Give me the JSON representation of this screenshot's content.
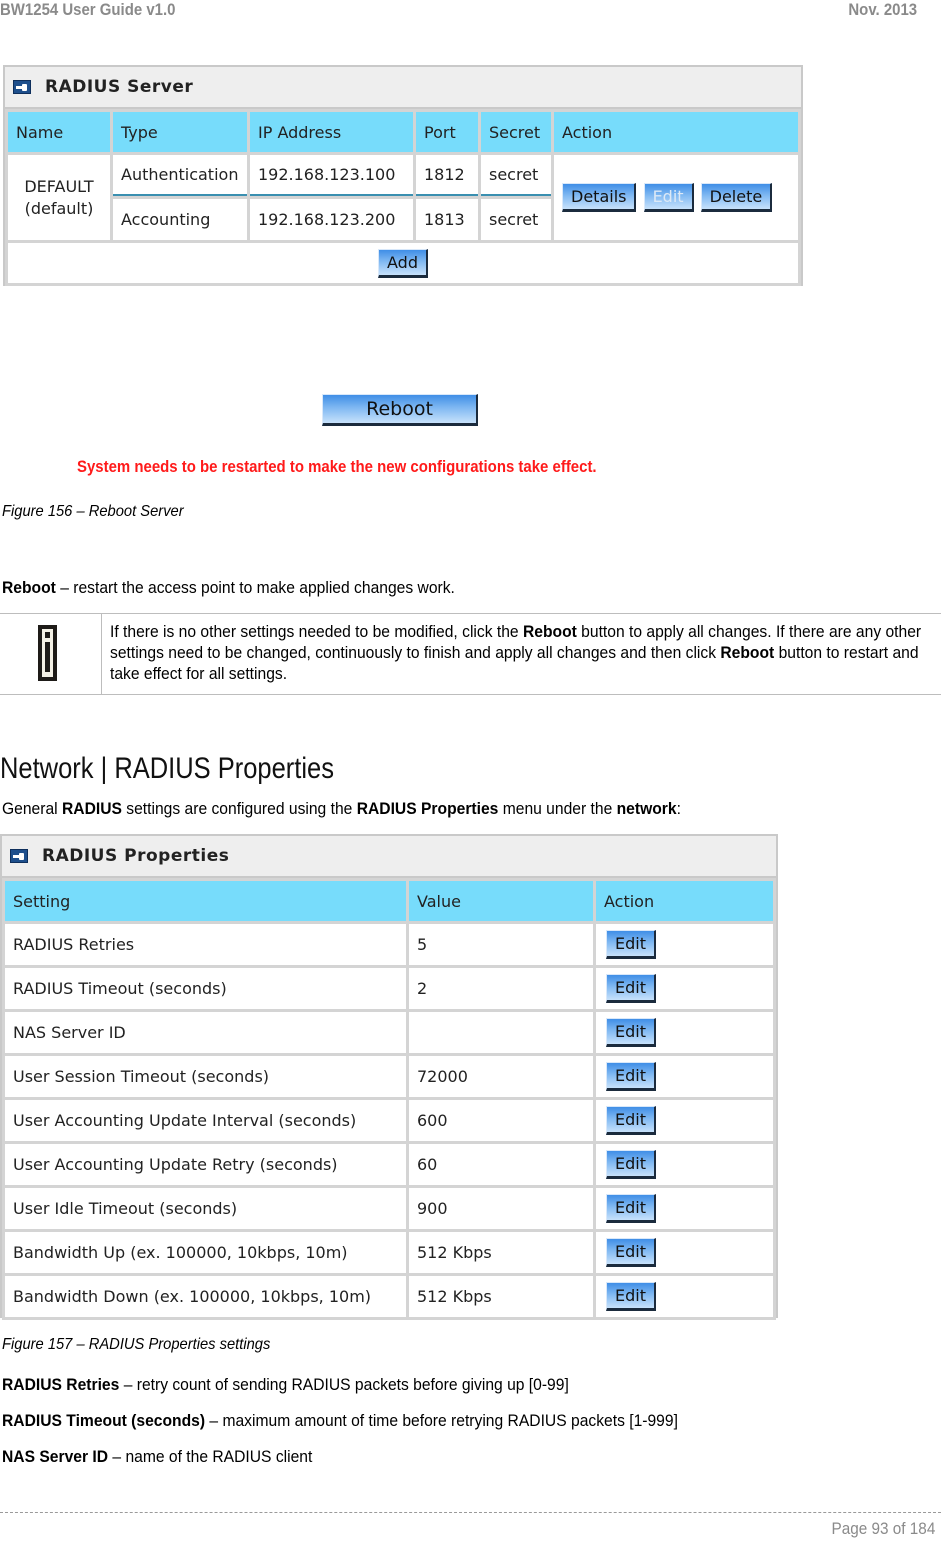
{
  "header": {
    "doc_title": "BW1254 User Guide v1.0",
    "date": "Nov.  2013"
  },
  "radius_server_panel": {
    "title": "RADIUS Server",
    "icon": "arrow-panel-icon",
    "columns": [
      "Name",
      "Type",
      "IP Address",
      "Port",
      "Secret",
      "Action"
    ],
    "server": {
      "name": "DEFAULT",
      "name_sub": "(default)",
      "entries": [
        {
          "type": "Authentication",
          "ip": "192.168.123.100",
          "port": "1812",
          "secret": "secret"
        },
        {
          "type": "Accounting",
          "ip": "192.168.123.200",
          "port": "1813",
          "secret": "secret"
        }
      ],
      "actions": {
        "details": "Details",
        "edit": "Edit",
        "delete": "Delete"
      }
    },
    "add_label": "Add",
    "header_color": "#77dcfb"
  },
  "reboot": {
    "button_label": "Reboot",
    "warning": "System needs to be restarted to make the new configurations take effect.",
    "warning_color": "#ff1a1a"
  },
  "figure156_caption": "Figure 156 – Reboot Server",
  "reboot_desc": {
    "term": "Reboot",
    "text": " – restart the access point to make applied changes work."
  },
  "note": {
    "icon": "info-icon",
    "parts": [
      "If there is no other settings needed to be modified, click the ",
      "Reboot",
      " button to apply all changes. If there are any other settings need to be changed, continuously to finish and apply all changes and then click ",
      "Reboot",
      " button to restart and take effect  for all settings."
    ]
  },
  "section": {
    "title": "Network | RADIUS Properties",
    "intro_parts": [
      "General ",
      "RADIUS",
      " settings are configured using the ",
      "RADIUS Properties",
      " menu under the ",
      "network",
      ":"
    ]
  },
  "radius_properties_panel": {
    "title": "RADIUS Properties",
    "columns": [
      "Setting",
      "Value",
      "Action"
    ],
    "rows": [
      {
        "setting": "RADIUS Retries",
        "value": "5",
        "action": "Edit"
      },
      {
        "setting": "RADIUS Timeout (seconds)",
        "value": "2",
        "action": "Edit"
      },
      {
        "setting": "NAS Server ID",
        "value": "",
        "action": "Edit"
      },
      {
        "setting": "User Session Timeout (seconds)",
        "value": "72000",
        "action": "Edit"
      },
      {
        "setting": "User Accounting Update Interval (seconds)",
        "value": "600",
        "action": "Edit"
      },
      {
        "setting": "User Accounting Update Retry (seconds)",
        "value": "60",
        "action": "Edit"
      },
      {
        "setting": "User Idle Timeout (seconds)",
        "value": "900",
        "action": "Edit"
      },
      {
        "setting": "Bandwidth Up (ex. 100000, 10kbps, 10m)",
        "value": "512 Kbps",
        "action": "Edit"
      },
      {
        "setting": "Bandwidth Down (ex. 100000, 10kbps, 10m)",
        "value": "512 Kbps",
        "action": "Edit"
      }
    ]
  },
  "figure157_caption": "Figure 157 – RADIUS Properties settings",
  "definitions": [
    {
      "term": "RADIUS Retries",
      "text": " – retry count of sending RADIUS packets before giving up [0-99]"
    },
    {
      "term": "RADIUS Timeout (seconds)",
      "text": " – maximum amount of time before retrying RADIUS packets [1-999]"
    },
    {
      "term": "NAS Server ID",
      "text": " – name of the RADIUS client"
    }
  ],
  "footer": {
    "page": "Page 93 of 184"
  }
}
